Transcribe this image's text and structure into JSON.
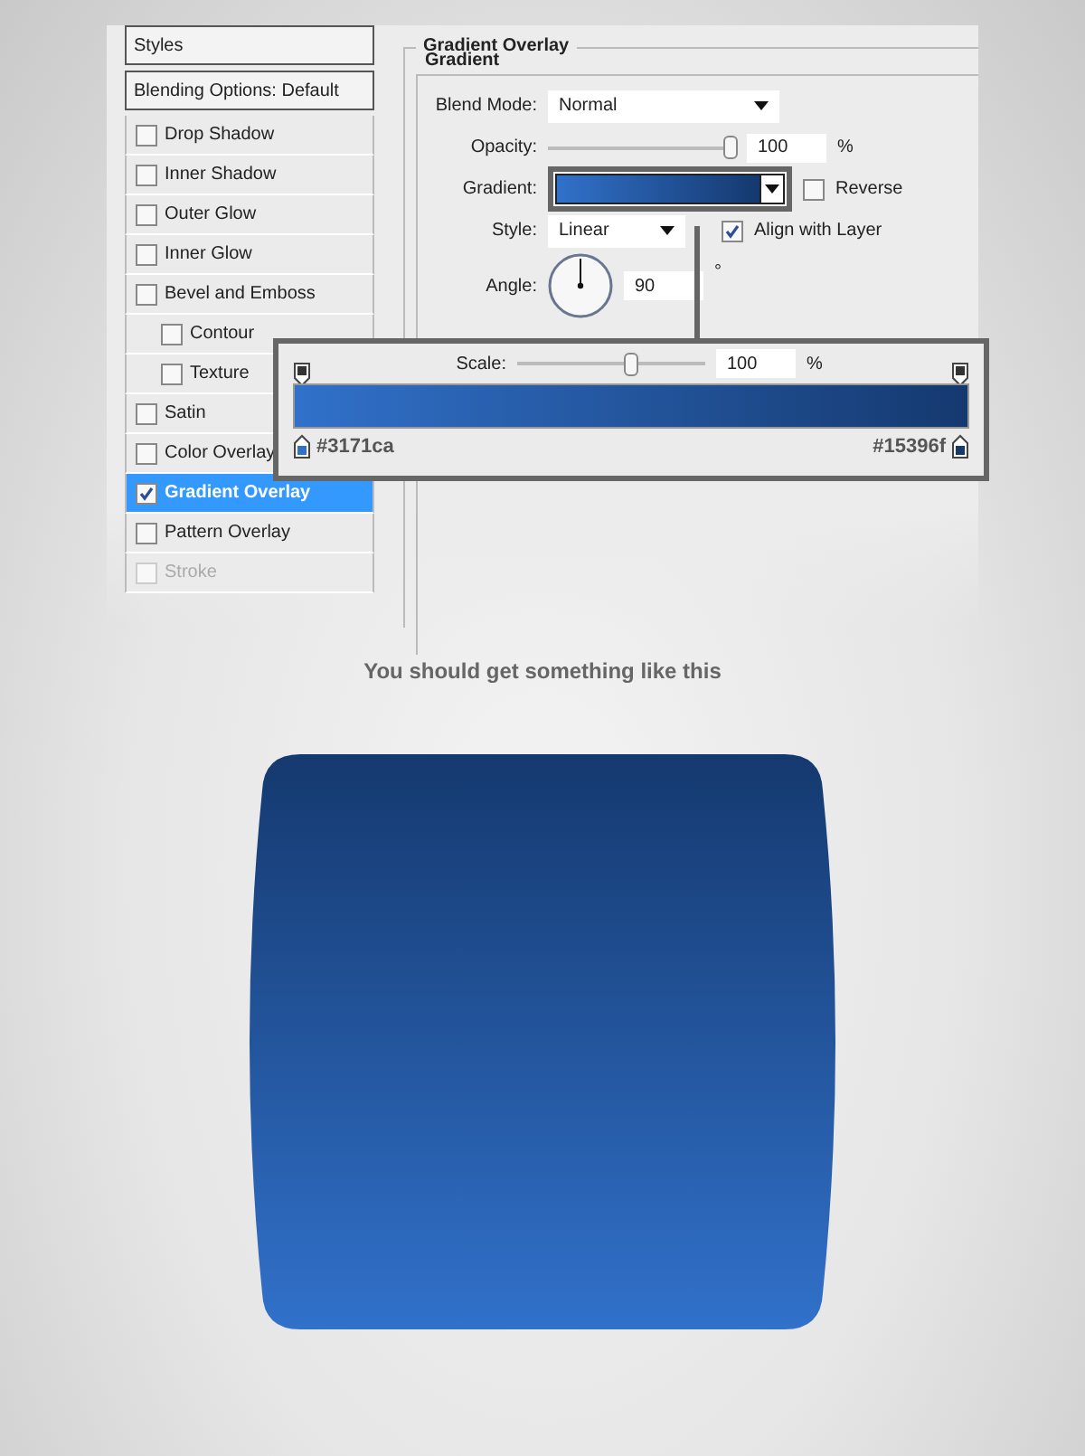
{
  "styles_panel": {
    "header": "Styles",
    "blending_options": "Blending Options: Default",
    "items": [
      {
        "label": "Drop Shadow",
        "checked": false,
        "selected": false,
        "disabled": false
      },
      {
        "label": "Inner Shadow",
        "checked": false,
        "selected": false,
        "disabled": false
      },
      {
        "label": "Outer Glow",
        "checked": false,
        "selected": false,
        "disabled": false
      },
      {
        "label": "Inner Glow",
        "checked": false,
        "selected": false,
        "disabled": false
      },
      {
        "label": "Bevel and Emboss",
        "checked": false,
        "selected": false,
        "disabled": false,
        "children": [
          {
            "label": "Contour",
            "checked": false,
            "selected": false,
            "disabled": false
          },
          {
            "label": "Texture",
            "checked": false,
            "selected": false,
            "disabled": false
          }
        ]
      },
      {
        "label": "Satin",
        "checked": false,
        "selected": false,
        "disabled": false
      },
      {
        "label": "Color Overlay",
        "checked": false,
        "selected": false,
        "disabled": false
      },
      {
        "label": "Gradient Overlay",
        "checked": true,
        "selected": true,
        "disabled": false
      },
      {
        "label": "Pattern Overlay",
        "checked": false,
        "selected": false,
        "disabled": false
      },
      {
        "label": "Stroke",
        "checked": false,
        "selected": false,
        "disabled": true
      }
    ]
  },
  "gradient_overlay": {
    "title": "Gradient Overlay",
    "group": "Gradient",
    "blend_mode": {
      "label": "Blend Mode:",
      "value": "Normal"
    },
    "opacity": {
      "label": "Opacity:",
      "value": "100",
      "unit": "%",
      "level": 0.98
    },
    "gradient": {
      "label": "Gradient:",
      "reverse": {
        "label": "Reverse",
        "checked": false
      }
    },
    "style": {
      "label": "Style:",
      "value": "Linear",
      "align_with_layer": {
        "label": "Align with Layer",
        "checked": true
      }
    },
    "angle": {
      "label": "Angle:",
      "value": "90",
      "unit": "°"
    },
    "scale": {
      "label": "Scale:",
      "value": "100",
      "unit": "%",
      "level": 0.62
    },
    "stops": [
      {
        "label": "#3171ca",
        "color": "#3171ca"
      },
      {
        "label": "#15396f",
        "color": "#15396f"
      }
    ]
  },
  "caption": "You should get something like this"
}
